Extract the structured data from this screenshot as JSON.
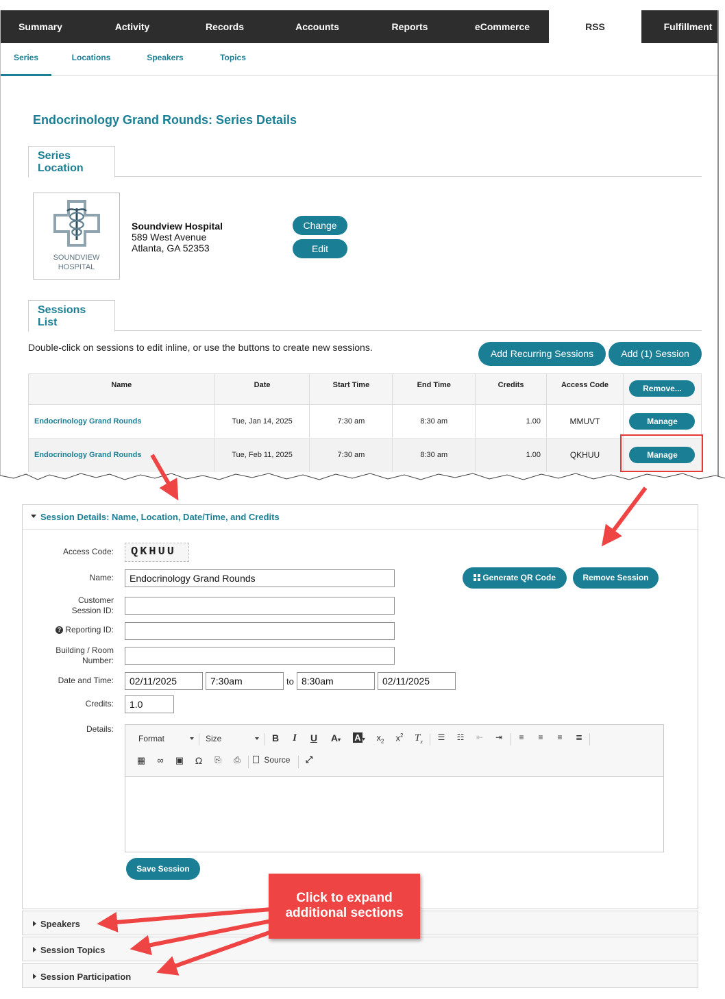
{
  "main_nav": [
    {
      "label": "Summary"
    },
    {
      "label": "Activity"
    },
    {
      "label": "Records"
    },
    {
      "label": "Accounts"
    },
    {
      "label": "Reports"
    },
    {
      "label": "eCommerce"
    },
    {
      "label": "RSS",
      "active": true
    },
    {
      "label": "Fulfillment"
    }
  ],
  "sub_nav": [
    {
      "label": "Series",
      "active": true
    },
    {
      "label": "Locations"
    },
    {
      "label": "Speakers"
    },
    {
      "label": "Topics"
    }
  ],
  "page_title": "Endocrinology Grand Rounds: Series Details",
  "series_location": {
    "tab_line1": "Series",
    "tab_line2": "Location",
    "logo_line1": "SOUNDVIEW",
    "logo_line2": "HOSPITAL",
    "name": "Soundview Hospital",
    "address1": "589 West Avenue",
    "address2": "Atlanta, GA 52353",
    "change_button": "Change",
    "edit_button": "Edit"
  },
  "sessions_list": {
    "tab_line1": "Sessions",
    "tab_line2": "List",
    "instructions": "Double-click on sessions to edit inline, or use the buttons to create new sessions.",
    "add_recurring_button": "Add Recurring Sessions",
    "add_session_button": "Add (1) Session",
    "columns": {
      "name": "Name",
      "date": "Date",
      "start": "Start Time",
      "end": "End Time",
      "credits": "Credits",
      "access_code": "Access Code",
      "remove": "Remove..."
    },
    "rows": [
      {
        "name": "Endocrinology Grand Rounds",
        "date": "Tue, Jan 14, 2025",
        "start": "7:30 am",
        "end": "8:30 am",
        "credits": "1.00",
        "access_code": "MMUVT",
        "action": "Manage"
      },
      {
        "name": "Endocrinology Grand Rounds",
        "date": "Tue, Feb 11, 2025",
        "start": "7:30 am",
        "end": "8:30 am",
        "credits": "1.00",
        "access_code": "QKHUU",
        "action": "Manage"
      }
    ]
  },
  "session_details": {
    "header": "Session Details: Name, Location, Date/Time, and Credits",
    "access_code_label": "Access Code:",
    "access_code": "QKHUU",
    "name_label": "Name:",
    "name_value": "Endocrinology Grand Rounds",
    "customer_id_label_1": "Customer",
    "customer_id_label_2": "Session ID:",
    "reporting_id_label": "Reporting ID:",
    "building_label_1": "Building / Room",
    "building_label_2": "Number:",
    "datetime_label": "Date and Time:",
    "start_date": "02/11/2025",
    "start_time": "7:30am",
    "to_label": "to",
    "end_time": "8:30am",
    "end_date": "02/11/2025",
    "credits_label": "Credits:",
    "credits_value": "1.0",
    "details_label": "Details:",
    "generate_qr_button": "Generate QR Code",
    "remove_session_button": "Remove Session",
    "save_button": "Save Session",
    "editor": {
      "format": "Format",
      "size": "Size",
      "source": "Source"
    }
  },
  "collapsed_sections": [
    {
      "label": "Speakers"
    },
    {
      "label": "Session Topics"
    },
    {
      "label": "Session Participation"
    }
  ],
  "callout": {
    "line1": "Click to expand",
    "line2": "additional sections"
  },
  "colors": {
    "accent": "#1a7f95",
    "nav_bg": "#2d2d2d",
    "callout": "#ef4444"
  }
}
